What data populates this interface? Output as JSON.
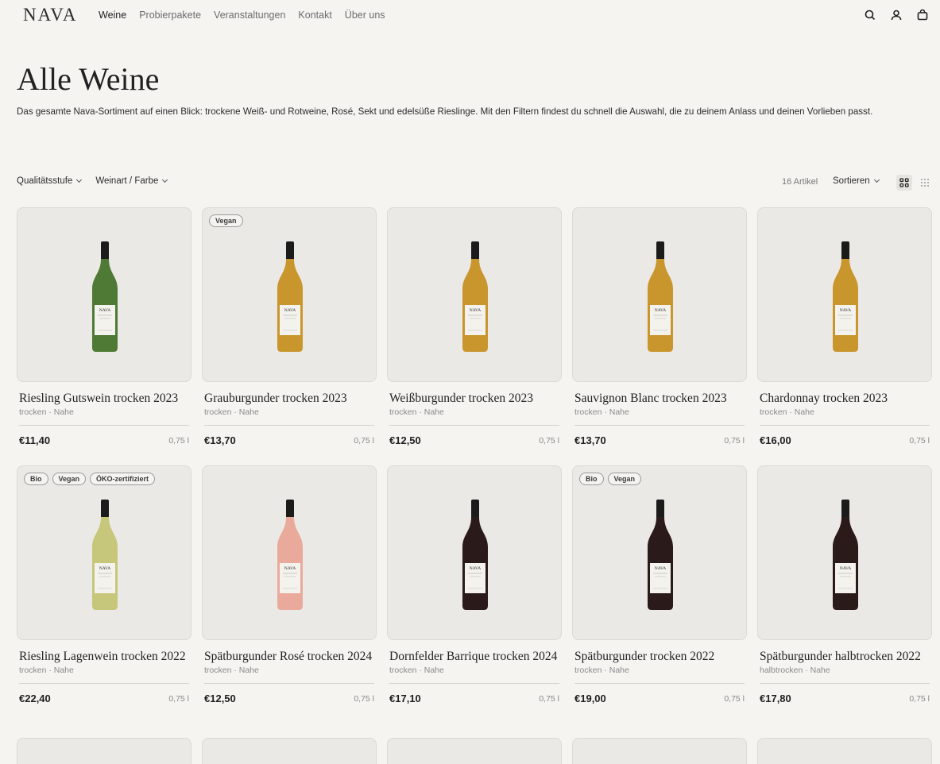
{
  "header": {
    "logo": "NAVA",
    "nav": [
      "Weine",
      "Probierpakete",
      "Veranstaltungen",
      "Kontakt",
      "Über uns"
    ],
    "icons": [
      "search-icon",
      "account-icon",
      "cart-icon"
    ]
  },
  "page": {
    "title": "Alle Weine",
    "description": "Das gesamte Nava-Sortiment auf einen Blick: trockene Weiß- und Rotweine, Rosé, Sekt und edelsüße Rieslinge. Mit den Filtern findest du schnell die Auswahl, die zu deinem Anlass und deinen Vorlieben passt."
  },
  "toolbar": {
    "filter1": "Qualitätsstufe",
    "filter2": "Weinart / Farbe",
    "count": "16 Artikel",
    "sort": "Sortieren"
  },
  "products": [
    {
      "name": "Riesling Gutswein trocken 2023",
      "sub": "trocken · Nahe",
      "price": "€11,40",
      "volume": "0,75 l",
      "badges": [],
      "wine_color": "#4f7a35",
      "label_text": "NAVA"
    },
    {
      "name": "Grauburgunder trocken 2023",
      "sub": "trocken · Nahe",
      "price": "€13,70",
      "volume": "0,75 l",
      "badges": [
        "Vegan"
      ],
      "wine_color": "#c9962e",
      "label_text": "NAVA"
    },
    {
      "name": "Weißburgunder trocken 2023",
      "sub": "trocken · Nahe",
      "price": "€12,50",
      "volume": "0,75 l",
      "badges": [],
      "wine_color": "#c9962e",
      "label_text": "NAVA"
    },
    {
      "name": "Sauvignon Blanc trocken 2023",
      "sub": "trocken · Nahe",
      "price": "€13,70",
      "volume": "0,75 l",
      "badges": [],
      "wine_color": "#c9962e",
      "label_text": "NAVA"
    },
    {
      "name": "Chardonnay trocken 2023",
      "sub": "trocken · Nahe",
      "price": "€16,00",
      "volume": "0,75 l",
      "badges": [],
      "wine_color": "#c9962e",
      "label_text": "NAVA"
    },
    {
      "name": "Riesling Lagenwein trocken 2022",
      "sub": "trocken · Nahe",
      "price": "€22,40",
      "volume": "0,75 l",
      "badges": [
        "Bio",
        "Vegan",
        "ÖKO-zertifiziert"
      ],
      "wine_color": "#c6c77a",
      "label_text": "NAVA"
    },
    {
      "name": "Spätburgunder Rosé trocken 2024",
      "sub": "trocken · Nahe",
      "price": "€12,50",
      "volume": "0,75 l",
      "badges": [],
      "wine_color": "#e9aa9c",
      "label_text": "NAVA"
    },
    {
      "name": "Dornfelder Barrique trocken 2024",
      "sub": "trocken · Nahe",
      "price": "€17,10",
      "volume": "0,75 l",
      "badges": [],
      "wine_color": "#2a1a1a",
      "label_text": "NAVA"
    },
    {
      "name": "Spätburgunder trocken 2022",
      "sub": "trocken · Nahe",
      "price": "€19,00",
      "volume": "0,75 l",
      "badges": [
        "Bio",
        "Vegan"
      ],
      "wine_color": "#2a1a1a",
      "label_text": "NAVA"
    },
    {
      "name": "Spätburgunder halbtrocken 2022",
      "sub": "halbtrocken · Nahe",
      "price": "€17,80",
      "volume": "0,75 l",
      "badges": [],
      "wine_color": "#2a1a1a",
      "label_text": "NAVA"
    }
  ]
}
